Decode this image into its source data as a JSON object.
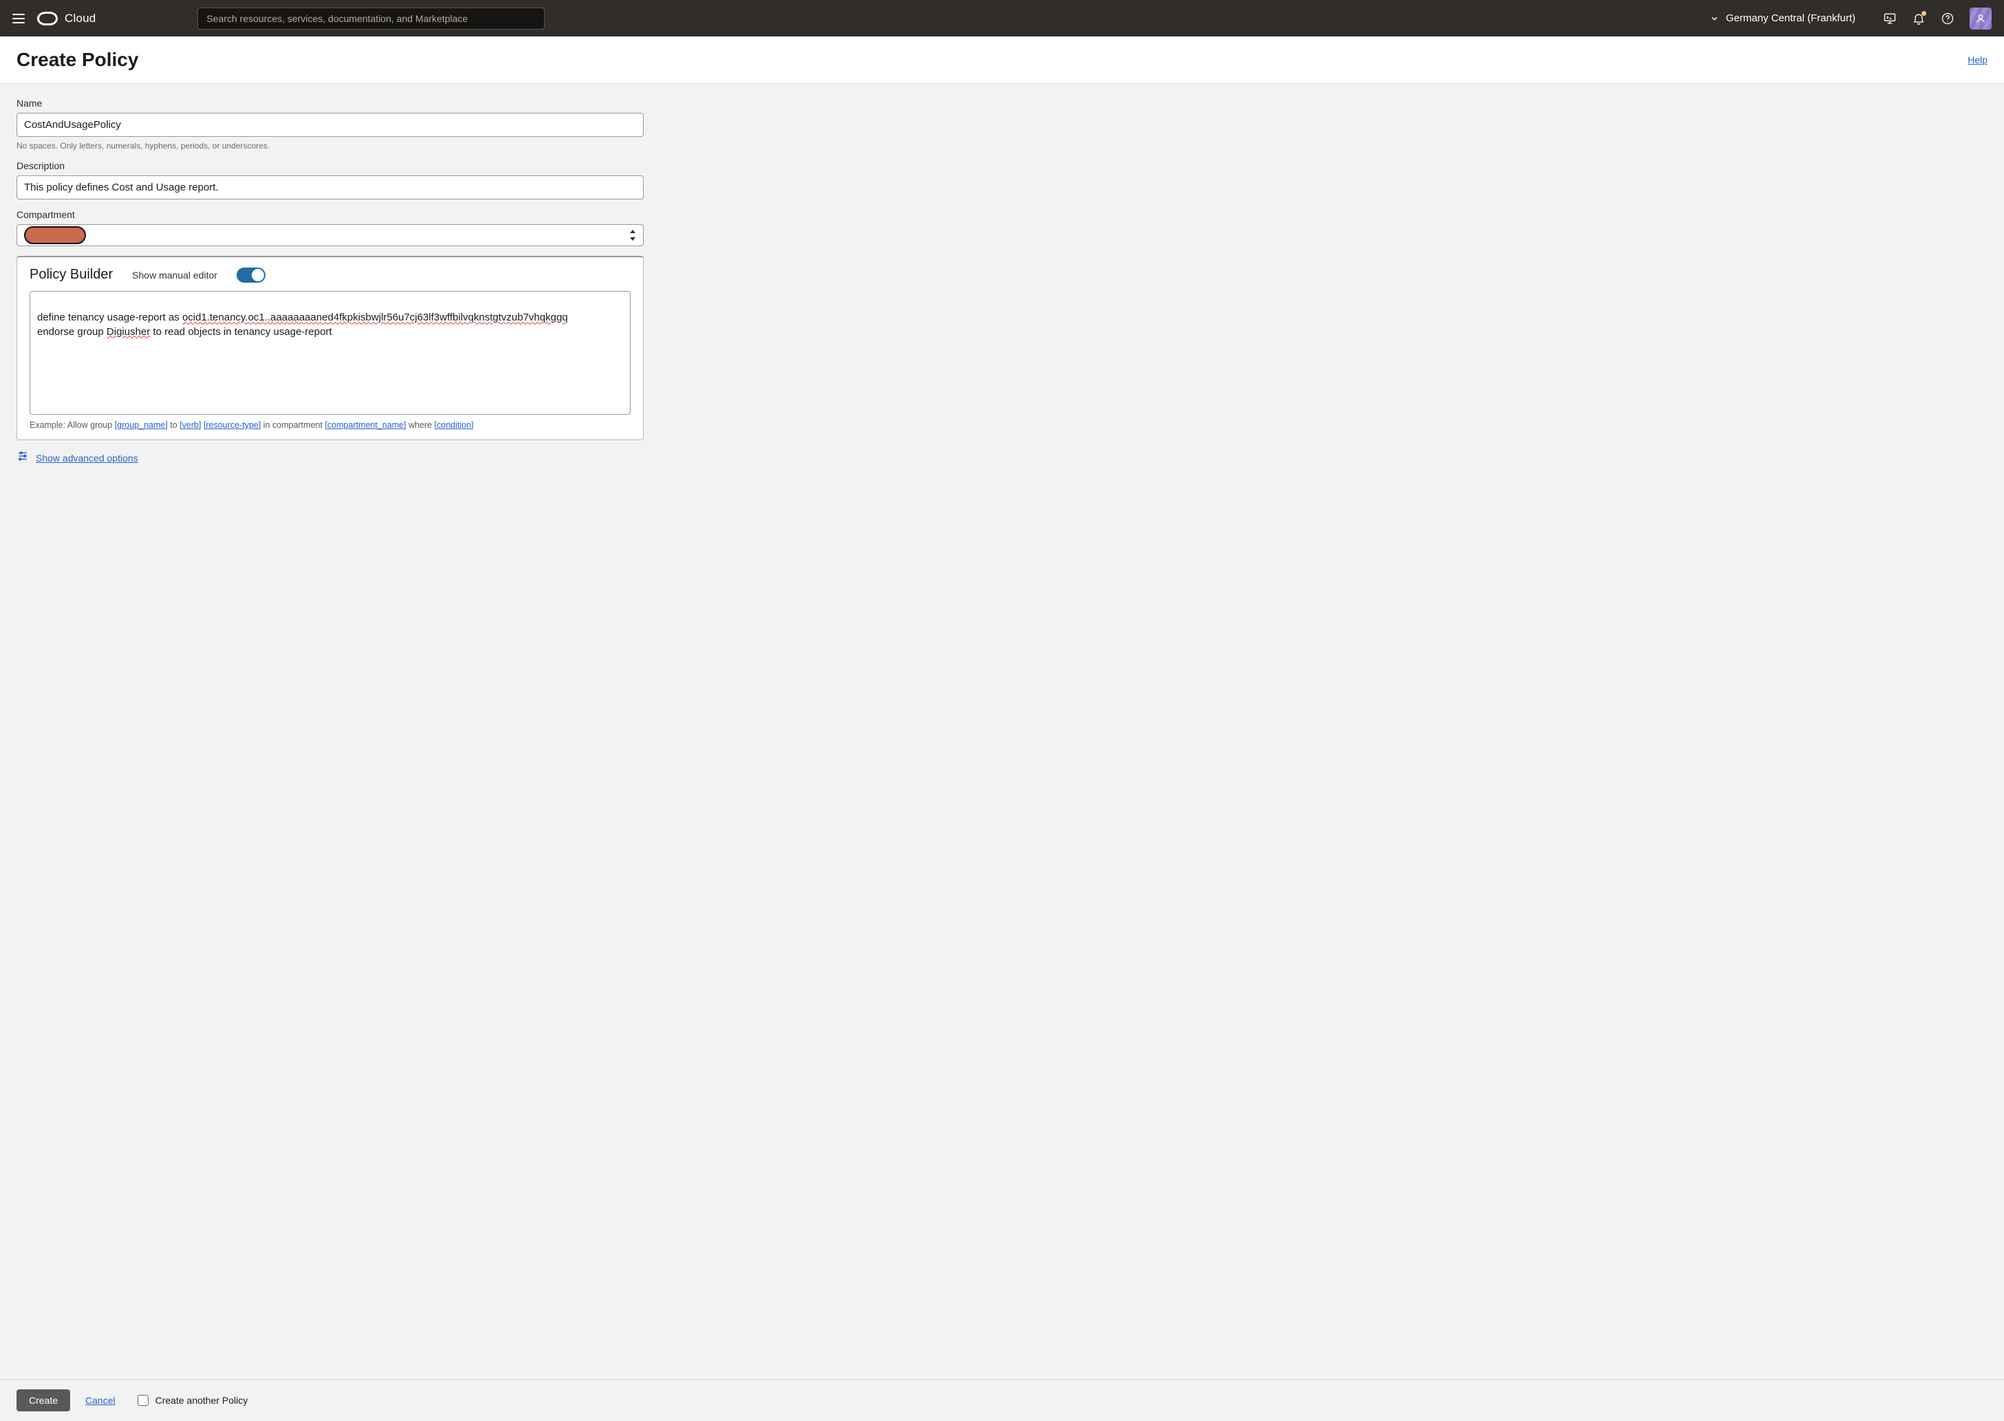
{
  "navbar": {
    "brand": "Cloud",
    "search_placeholder": "Search resources, services, documentation, and Marketplace",
    "region": "Germany Central (Frankfurt)"
  },
  "header": {
    "title": "Create Policy",
    "help": "Help"
  },
  "form": {
    "name": {
      "label": "Name",
      "value": "CostAndUsagePolicy",
      "hint": "No spaces. Only letters, numerals, hyphens, periods, or underscores."
    },
    "description": {
      "label": "Description",
      "value": "This policy defines Cost and Usage report."
    },
    "compartment": {
      "label": "Compartment"
    },
    "builder": {
      "title": "Policy Builder",
      "toggle_label": "Show manual editor",
      "policy_line1_pre": "define tenancy usage-report as ",
      "policy_line1_spell": "ocid1.tenancy.oc1..aaaaaaaaned4fkpkisbwjlr56u7cj63lf3wffbilvqknstgtvzub7vhqkggq",
      "policy_line2_pre": "endorse group ",
      "policy_line2_spell": "Digiusher",
      "policy_line2_post": " to read objects in tenancy usage-report",
      "example_pre": "Example: Allow group ",
      "example_group": "[group_name]",
      "example_to": " to ",
      "example_verb": "[verb]",
      "example_sp": " ",
      "example_res": "[resource-type]",
      "example_in": " in compartment ",
      "example_comp": "[compartment_name]",
      "example_where": " where ",
      "example_cond": "[condition]"
    },
    "advanced": "Show advanced options"
  },
  "footer": {
    "create": "Create",
    "cancel": "Cancel",
    "create_another": "Create another Policy"
  }
}
